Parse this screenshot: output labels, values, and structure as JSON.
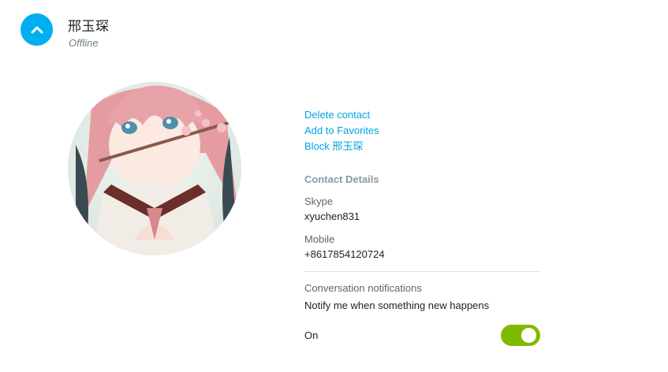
{
  "header": {
    "name": "邢玉琛",
    "status": "Offline"
  },
  "avatar": {
    "icon": "anime-girl-avatar"
  },
  "actions": {
    "delete_contact": "Delete contact",
    "add_favorites": "Add to Favorites",
    "block": "Block 邢玉琛"
  },
  "contact_details": {
    "title": "Contact Details",
    "skype_label": "Skype",
    "skype_value": "xyuchen831",
    "mobile_label": "Mobile",
    "mobile_value": "+8617854120724"
  },
  "notifications": {
    "label": "Conversation notifications",
    "description": "Notify me when something new happens",
    "toggle_label": "On",
    "toggle_on": true
  },
  "colors": {
    "accent": "#00aff0",
    "link": "#00a4e4",
    "toggle_on": "#7fba00"
  }
}
